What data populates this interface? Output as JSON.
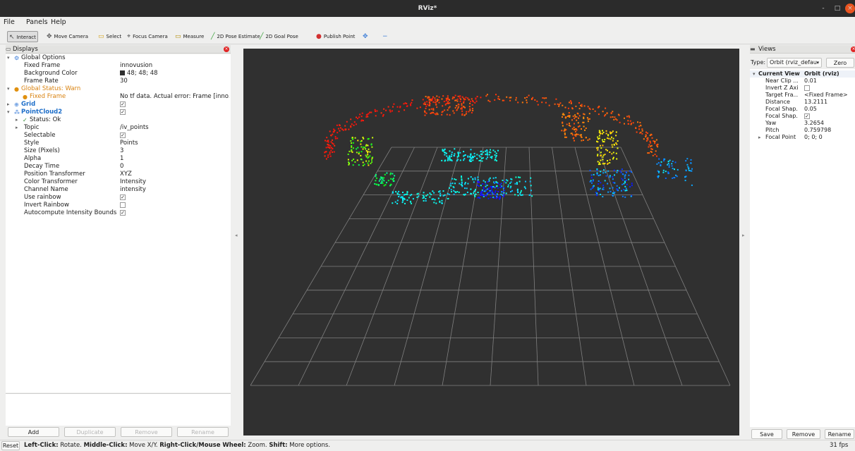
{
  "window": {
    "title": "RViz*",
    "controls": [
      "-",
      "□",
      "×"
    ]
  },
  "menu": [
    "File",
    "Panels",
    "Help"
  ],
  "toolbar": [
    {
      "label": "Interact",
      "icon": "pointer-icon",
      "glyph": "↖",
      "color": "#444444"
    },
    {
      "label": "Move Camera",
      "icon": "move-camera-icon",
      "glyph": "✥",
      "color": "#555555"
    },
    {
      "label": "Select",
      "icon": "select-icon",
      "glyph": "▭",
      "color": "#d4a017"
    },
    {
      "label": "Focus Camera",
      "icon": "focus-camera-icon",
      "glyph": "⌖",
      "color": "#555555"
    },
    {
      "label": "Measure",
      "icon": "ruler-icon",
      "glyph": "▭",
      "color": "#b08a00"
    },
    {
      "label": "2D Pose Estimate",
      "icon": "pose-estimate-icon",
      "glyph": "╱",
      "color": "#3aa33a"
    },
    {
      "label": "2D Goal Pose",
      "icon": "goal-pose-icon",
      "glyph": "╱",
      "color": "#3aa33a"
    },
    {
      "label": "Publish Point",
      "icon": "map-pin-icon",
      "glyph": "●",
      "color": "#d23030"
    },
    {
      "label": "",
      "icon": "move-icon",
      "glyph": "✥",
      "color": "#3f7fd8"
    },
    {
      "label": "",
      "icon": "minus-icon",
      "glyph": "−",
      "color": "#3f7fd8"
    }
  ],
  "displays": {
    "title": "Displays",
    "rows": [
      {
        "label": "Global Options",
        "value": "",
        "indent": 1,
        "expander": "▾",
        "icon": "gear-icon",
        "glyph": "⚙",
        "iconColor": "#3f7fd8",
        "style": ""
      },
      {
        "label": "Fixed Frame",
        "value": "innovusion",
        "indent": 2,
        "style": ""
      },
      {
        "label": "Background Color",
        "value": "48; 48; 48",
        "indent": 2,
        "swatch": "#303030",
        "style": ""
      },
      {
        "label": "Frame Rate",
        "value": "30",
        "indent": 2,
        "style": ""
      },
      {
        "label": "Global Status: Warn",
        "value": "",
        "indent": 1,
        "expander": "▾",
        "icon": "warning-icon",
        "glyph": "●",
        "iconColor": "#e0900f",
        "style": "orange"
      },
      {
        "label": "Fixed Frame",
        "value": "No tf data.  Actual error: Frame [inno...",
        "indent": 2,
        "icon": "warning-icon",
        "glyph": "●",
        "iconColor": "#e0900f",
        "style": "orange"
      },
      {
        "label": "Grid",
        "value": "",
        "indent": 1,
        "expander": "▸",
        "icon": "grid-icon",
        "glyph": "⊕",
        "iconColor": "#3f7fd8",
        "style": "blue",
        "check": true
      },
      {
        "label": "PointCloud2",
        "value": "",
        "indent": 1,
        "expander": "▾",
        "icon": "pointcloud-icon",
        "glyph": "⁂",
        "iconColor": "#3f7fd8",
        "style": "blue",
        "check": true
      },
      {
        "label": "Status: Ok",
        "value": "",
        "indent": 2,
        "expander": "▸",
        "icon": "check-icon",
        "glyph": "✓",
        "iconColor": "#2d8a2d",
        "style": ""
      },
      {
        "label": "Topic",
        "value": "/iv_points",
        "indent": 2,
        "expander": "▸",
        "style": ""
      },
      {
        "label": "Selectable",
        "value": "",
        "indent": 2,
        "check": true,
        "style": ""
      },
      {
        "label": "Style",
        "value": "Points",
        "indent": 2,
        "style": ""
      },
      {
        "label": "Size (Pixels)",
        "value": "3",
        "indent": 2,
        "style": ""
      },
      {
        "label": "Alpha",
        "value": "1",
        "indent": 2,
        "style": ""
      },
      {
        "label": "Decay Time",
        "value": "0",
        "indent": 2,
        "style": ""
      },
      {
        "label": "Position Transformer",
        "value": "XYZ",
        "indent": 2,
        "style": ""
      },
      {
        "label": "Color Transformer",
        "value": "Intensity",
        "indent": 2,
        "style": ""
      },
      {
        "label": "Channel Name",
        "value": "intensity",
        "indent": 2,
        "style": ""
      },
      {
        "label": "Use rainbow",
        "value": "",
        "indent": 2,
        "check": true,
        "style": ""
      },
      {
        "label": "Invert Rainbow",
        "value": "",
        "indent": 2,
        "check": false,
        "style": ""
      },
      {
        "label": "Autocompute Intensity Bounds",
        "value": "",
        "indent": 2,
        "check": true,
        "style": ""
      }
    ],
    "buttons": {
      "add": "Add",
      "duplicate": "Duplicate",
      "remove": "Remove",
      "rename": "Rename"
    }
  },
  "views": {
    "title": "Views",
    "type_label": "Type:",
    "type_value": "Orbit (rviz_defau",
    "zero": "Zero",
    "rows": [
      {
        "label": "Current View",
        "value": "Orbit (rviz)",
        "bold": true,
        "expander": "▾"
      },
      {
        "label": "Near Clip ...",
        "value": "0.01"
      },
      {
        "label": "Invert Z Axis",
        "value": "",
        "check": false
      },
      {
        "label": "Target Fra...",
        "value": "<Fixed Frame>"
      },
      {
        "label": "Distance",
        "value": "13.2111"
      },
      {
        "label": "Focal Shap...",
        "value": "0.05"
      },
      {
        "label": "Focal Shap...",
        "value": "",
        "check": true
      },
      {
        "label": "Yaw",
        "value": "3.2654"
      },
      {
        "label": "Pitch",
        "value": "0.759798"
      },
      {
        "label": "Focal Point",
        "value": "0; 0; 0",
        "expander": "▸"
      }
    ],
    "buttons": {
      "save": "Save",
      "remove": "Remove",
      "rename": "Rename"
    }
  },
  "status": {
    "reset": "Reset",
    "h1": "Left-Click:",
    "t1": " Rotate. ",
    "h2": "Middle-Click:",
    "t2": " Move X/Y. ",
    "h3": "Right-Click/Mouse Wheel:",
    "t3": " Zoom. ",
    "h4": "Shift:",
    "t4": " More options.",
    "fps": "31 fps"
  },
  "colors": {
    "viewport_bg": "#303030",
    "grid": "#9a9a9a",
    "accent": "#1f6fc9",
    "warn": "#d9820f"
  }
}
